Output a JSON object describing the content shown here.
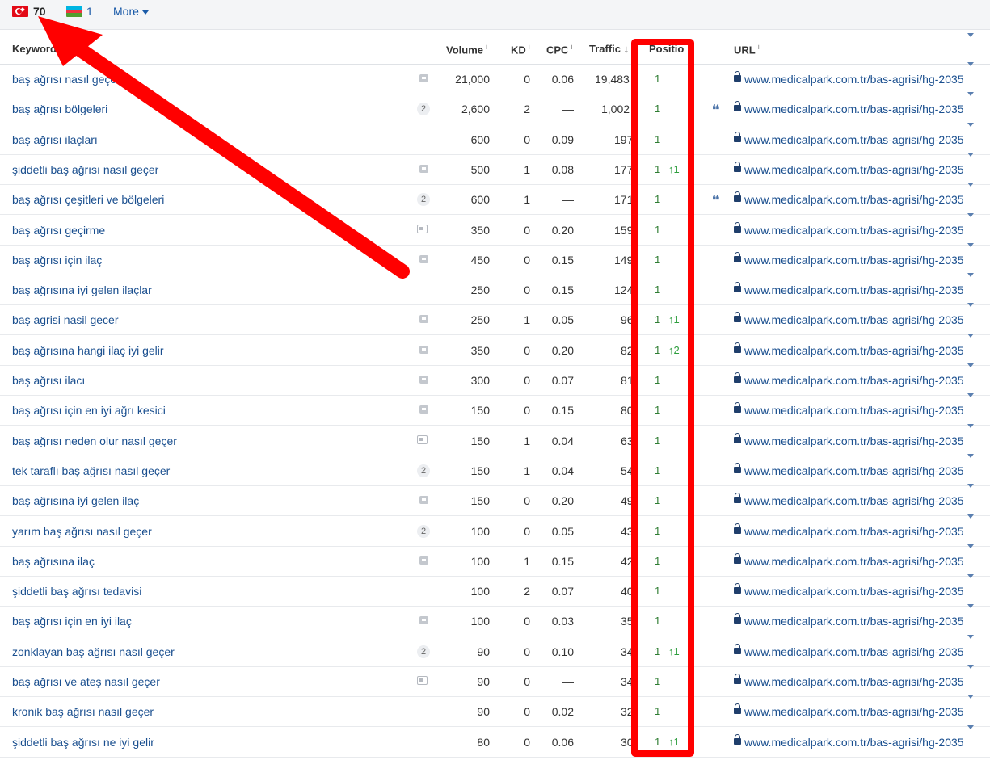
{
  "topbar": {
    "countries": [
      {
        "flag": "turkey-flag-icon",
        "count": "70"
      },
      {
        "flag": "azerbaijan-flag-icon",
        "count": "1"
      }
    ],
    "more_label": "More",
    "az_colors": [
      "#00b5e2",
      "#ef3340",
      "#509e2f"
    ]
  },
  "headers": {
    "keyword": "Keyword",
    "volume": "Volume",
    "kd": "KD",
    "cpc": "CPC",
    "traffic": "Traffic",
    "traffic_sort": "↓",
    "position": "Positio",
    "url": "URL",
    "info": "i"
  },
  "rows": [
    {
      "keyword": "baş ağrısı nasıl geçer",
      "badge": "q",
      "volume": "21,000",
      "kd": "0",
      "cpc": "0.06",
      "traffic": "19,483",
      "position": "1",
      "change": "",
      "quote": false,
      "url": "www.medicalpark.com.tr/bas-agrisi/hg-2035"
    },
    {
      "keyword": "baş ağrısı bölgeleri",
      "badge": "2",
      "volume": "2,600",
      "kd": "2",
      "cpc": "—",
      "traffic": "1,002",
      "position": "1",
      "change": "",
      "quote": true,
      "url": "www.medicalpark.com.tr/bas-agrisi/hg-2035"
    },
    {
      "keyword": "baş ağrısı ilaçları",
      "badge": "",
      "volume": "600",
      "kd": "0",
      "cpc": "0.09",
      "traffic": "197",
      "position": "1",
      "change": "",
      "quote": false,
      "url": "www.medicalpark.com.tr/bas-agrisi/hg-2035"
    },
    {
      "keyword": "şiddetli baş ağrısı nasıl geçer",
      "badge": "q",
      "volume": "500",
      "kd": "1",
      "cpc": "0.08",
      "traffic": "177",
      "position": "1",
      "change": "↑1",
      "quote": false,
      "url": "www.medicalpark.com.tr/bas-agrisi/hg-2035"
    },
    {
      "keyword": "baş ağrısı çeşitleri ve bölgeleri",
      "badge": "2",
      "volume": "600",
      "kd": "1",
      "cpc": "—",
      "traffic": "171",
      "position": "1",
      "change": "",
      "quote": true,
      "url": "www.medicalpark.com.tr/bas-agrisi/hg-2035"
    },
    {
      "keyword": "baş ağrısı geçirme",
      "badge": "img",
      "volume": "350",
      "kd": "0",
      "cpc": "0.20",
      "traffic": "159",
      "position": "1",
      "change": "",
      "quote": false,
      "url": "www.medicalpark.com.tr/bas-agrisi/hg-2035"
    },
    {
      "keyword": "baş ağrısı için ilaç",
      "badge": "q",
      "volume": "450",
      "kd": "0",
      "cpc": "0.15",
      "traffic": "149",
      "position": "1",
      "change": "",
      "quote": false,
      "url": "www.medicalpark.com.tr/bas-agrisi/hg-2035"
    },
    {
      "keyword": "baş ağrısına iyi gelen ilaçlar",
      "badge": "",
      "volume": "250",
      "kd": "0",
      "cpc": "0.15",
      "traffic": "124",
      "position": "1",
      "change": "",
      "quote": false,
      "url": "www.medicalpark.com.tr/bas-agrisi/hg-2035"
    },
    {
      "keyword": "baş agrisi nasil gecer",
      "badge": "q",
      "volume": "250",
      "kd": "1",
      "cpc": "0.05",
      "traffic": "96",
      "position": "1",
      "change": "↑1",
      "quote": false,
      "url": "www.medicalpark.com.tr/bas-agrisi/hg-2035"
    },
    {
      "keyword": "baş ağrısına hangi ilaç iyi gelir",
      "badge": "q",
      "volume": "350",
      "kd": "0",
      "cpc": "0.20",
      "traffic": "82",
      "position": "1",
      "change": "↑2",
      "quote": false,
      "url": "www.medicalpark.com.tr/bas-agrisi/hg-2035"
    },
    {
      "keyword": "baş ağrısı ilacı",
      "badge": "q",
      "volume": "300",
      "kd": "0",
      "cpc": "0.07",
      "traffic": "81",
      "position": "1",
      "change": "",
      "quote": false,
      "url": "www.medicalpark.com.tr/bas-agrisi/hg-2035"
    },
    {
      "keyword": "baş ağrısı için en iyi ağrı kesici",
      "badge": "q",
      "volume": "150",
      "kd": "0",
      "cpc": "0.15",
      "traffic": "80",
      "position": "1",
      "change": "",
      "quote": false,
      "url": "www.medicalpark.com.tr/bas-agrisi/hg-2035"
    },
    {
      "keyword": "baş ağrısı neden olur nasıl geçer",
      "badge": "img",
      "volume": "150",
      "kd": "1",
      "cpc": "0.04",
      "traffic": "63",
      "position": "1",
      "change": "",
      "quote": false,
      "url": "www.medicalpark.com.tr/bas-agrisi/hg-2035"
    },
    {
      "keyword": "tek taraflı baş ağrısı nasıl geçer",
      "badge": "2",
      "volume": "150",
      "kd": "1",
      "cpc": "0.04",
      "traffic": "54",
      "position": "1",
      "change": "",
      "quote": false,
      "url": "www.medicalpark.com.tr/bas-agrisi/hg-2035"
    },
    {
      "keyword": "baş ağrısına iyi gelen ilaç",
      "badge": "q",
      "volume": "150",
      "kd": "0",
      "cpc": "0.20",
      "traffic": "49",
      "position": "1",
      "change": "",
      "quote": false,
      "url": "www.medicalpark.com.tr/bas-agrisi/hg-2035"
    },
    {
      "keyword": "yarım baş ağrısı nasıl geçer",
      "badge": "2",
      "volume": "100",
      "kd": "0",
      "cpc": "0.05",
      "traffic": "43",
      "position": "1",
      "change": "",
      "quote": false,
      "url": "www.medicalpark.com.tr/bas-agrisi/hg-2035"
    },
    {
      "keyword": "baş ağrısına ilaç",
      "badge": "q",
      "volume": "100",
      "kd": "1",
      "cpc": "0.15",
      "traffic": "42",
      "position": "1",
      "change": "",
      "quote": false,
      "url": "www.medicalpark.com.tr/bas-agrisi/hg-2035"
    },
    {
      "keyword": "şiddetli baş ağrısı tedavisi",
      "badge": "",
      "volume": "100",
      "kd": "2",
      "cpc": "0.07",
      "traffic": "40",
      "position": "1",
      "change": "",
      "quote": false,
      "url": "www.medicalpark.com.tr/bas-agrisi/hg-2035"
    },
    {
      "keyword": "baş ağrısı için en iyi ilaç",
      "badge": "q",
      "volume": "100",
      "kd": "0",
      "cpc": "0.03",
      "traffic": "35",
      "position": "1",
      "change": "",
      "quote": false,
      "url": "www.medicalpark.com.tr/bas-agrisi/hg-2035"
    },
    {
      "keyword": "zonklayan baş ağrısı nasıl geçer",
      "badge": "2",
      "volume": "90",
      "kd": "0",
      "cpc": "0.10",
      "traffic": "34",
      "position": "1",
      "change": "↑1",
      "quote": false,
      "url": "www.medicalpark.com.tr/bas-agrisi/hg-2035"
    },
    {
      "keyword": "baş ağrısı ve ateş nasıl geçer",
      "badge": "img",
      "volume": "90",
      "kd": "0",
      "cpc": "—",
      "traffic": "34",
      "position": "1",
      "change": "",
      "quote": false,
      "url": "www.medicalpark.com.tr/bas-agrisi/hg-2035"
    },
    {
      "keyword": "kronik baş ağrısı nasıl geçer",
      "badge": "",
      "volume": "90",
      "kd": "0",
      "cpc": "0.02",
      "traffic": "32",
      "position": "1",
      "change": "",
      "quote": false,
      "url": "www.medicalpark.com.tr/bas-agrisi/hg-2035"
    },
    {
      "keyword": "şiddetli baş ağrısı ne iyi gelir",
      "badge": "",
      "volume": "80",
      "kd": "0",
      "cpc": "0.06",
      "traffic": "30",
      "position": "1",
      "change": "↑1",
      "quote": false,
      "url": "www.medicalpark.com.tr/bas-agrisi/hg-2035"
    }
  ],
  "annotations": {
    "highlight_color": "#ff0000"
  }
}
